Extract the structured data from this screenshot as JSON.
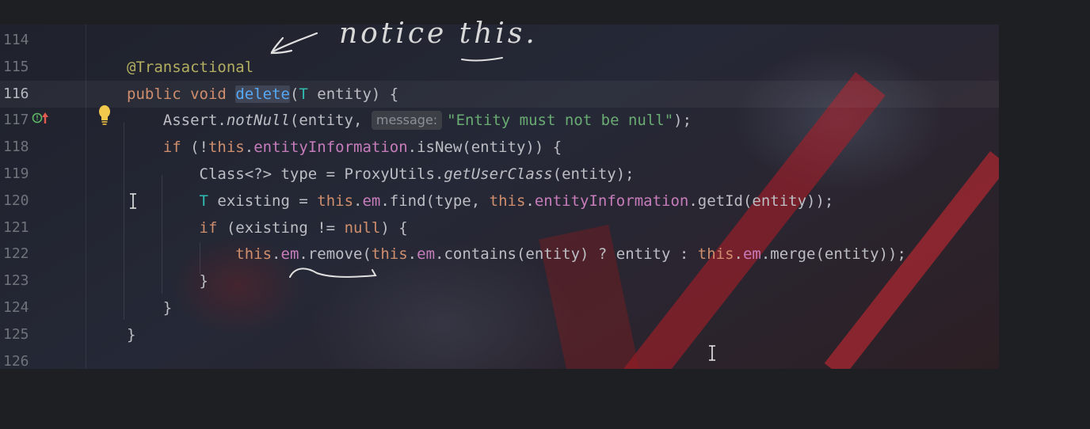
{
  "editor": {
    "lines": [
      {
        "number": "114",
        "tokens": []
      },
      {
        "number": "115",
        "tokens": [
          {
            "t": "@Transactional",
            "c": "ann"
          }
        ]
      },
      {
        "number": "116",
        "current": true,
        "tokens": [
          {
            "t": "public",
            "c": "kw"
          },
          {
            "t": " "
          },
          {
            "t": "void",
            "c": "kw"
          },
          {
            "t": " "
          },
          {
            "t": "delete",
            "c": "fn hl-usage"
          },
          {
            "t": "("
          },
          {
            "t": "T",
            "c": "typ"
          },
          {
            "t": " entity) {"
          }
        ]
      },
      {
        "number": "117",
        "tokens": [
          {
            "t": "    Assert."
          },
          {
            "t": "notNull",
            "c": "ital"
          },
          {
            "t": "(entity, "
          },
          {
            "t": "message:",
            "c": "hint"
          },
          {
            "t": "\"Entity must not be null\"",
            "c": "str"
          },
          {
            "t": ");"
          }
        ]
      },
      {
        "number": "118",
        "tokens": [
          {
            "t": "    "
          },
          {
            "t": "if",
            "c": "kw"
          },
          {
            "t": " (!"
          },
          {
            "t": "this",
            "c": "kw"
          },
          {
            "t": "."
          },
          {
            "t": "entityInformation",
            "c": "fld"
          },
          {
            "t": ".isNew(entity)) {"
          }
        ]
      },
      {
        "number": "119",
        "tokens": [
          {
            "t": "        Class<?> type = ProxyUtils."
          },
          {
            "t": "getUserClass",
            "c": "ital"
          },
          {
            "t": "(entity);"
          }
        ]
      },
      {
        "number": "120",
        "tokens": [
          {
            "t": "        "
          },
          {
            "t": "T",
            "c": "typ"
          },
          {
            "t": " existing = "
          },
          {
            "t": "this",
            "c": "kw"
          },
          {
            "t": "."
          },
          {
            "t": "em",
            "c": "fld"
          },
          {
            "t": ".find(type, "
          },
          {
            "t": "this",
            "c": "kw"
          },
          {
            "t": "."
          },
          {
            "t": "entityInformation",
            "c": "fld"
          },
          {
            "t": ".getId(entity));"
          }
        ]
      },
      {
        "number": "121",
        "tokens": [
          {
            "t": "        "
          },
          {
            "t": "if",
            "c": "kw"
          },
          {
            "t": " (existing != "
          },
          {
            "t": "null",
            "c": "kw"
          },
          {
            "t": ") {"
          }
        ]
      },
      {
        "number": "122",
        "tokens": [
          {
            "t": "            "
          },
          {
            "t": "this",
            "c": "kw"
          },
          {
            "t": "."
          },
          {
            "t": "em",
            "c": "fld"
          },
          {
            "t": ".remove("
          },
          {
            "t": "this",
            "c": "kw"
          },
          {
            "t": "."
          },
          {
            "t": "em",
            "c": "fld"
          },
          {
            "t": ".contains(entity) ? entity : "
          },
          {
            "t": "this",
            "c": "kw"
          },
          {
            "t": "."
          },
          {
            "t": "em",
            "c": "fld"
          },
          {
            "t": ".merge(entity));"
          }
        ]
      },
      {
        "number": "123",
        "tokens": [
          {
            "t": "        }"
          }
        ]
      },
      {
        "number": "124",
        "tokens": [
          {
            "t": "    }"
          }
        ]
      },
      {
        "number": "125",
        "tokens": [
          {
            "t": "}"
          }
        ]
      },
      {
        "number": "126",
        "tokens": []
      }
    ]
  },
  "annotation": {
    "note_text": "notice this."
  },
  "icons": {
    "gutter": "implemented-method-icon",
    "intention": "lightbulb-icon",
    "cursor": "text-cursor-icon"
  },
  "colors": {
    "keyword": "#cf8e6d",
    "annotation": "#b3ae60",
    "field": "#c77dbb",
    "string": "#6aab73",
    "type_param": "#2fbcb0",
    "text": "#bcbec4"
  }
}
